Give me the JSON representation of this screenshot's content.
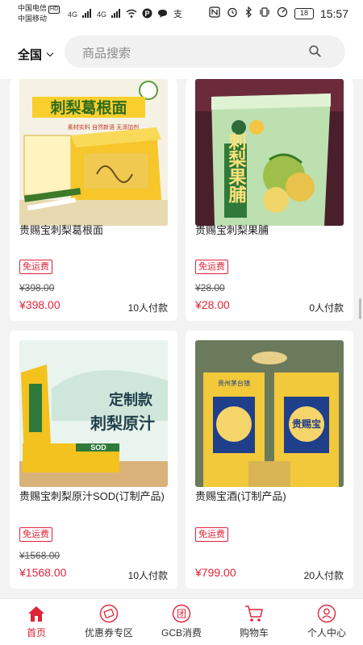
{
  "status_bar": {
    "carrier1": "中国电信",
    "carrier2": "中国移动",
    "hd": "HD",
    "net1": "4G",
    "net2": "4G",
    "battery": "18",
    "time": "15:57"
  },
  "header": {
    "region_label": "全国",
    "search_placeholder": "商品搜索"
  },
  "products": [
    {
      "name": "贵赐宝刺梨葛根面",
      "badge": "免运费",
      "original_price": "¥398.00",
      "price": "¥398.00",
      "paid_count": "10人付款",
      "image_text": {
        "title": "刺梨葛根面",
        "tags": "素材实料  自然新语  无添加剂"
      }
    },
    {
      "name": "贵赐宝刺梨果脯",
      "badge": "免运费",
      "original_price": "¥28.00",
      "price": "¥28.00",
      "paid_count": "0人付款",
      "image_text": {
        "title": "刺梨果脯"
      }
    },
    {
      "name": "贵赐宝刺梨原汁SOD(订制产品)",
      "badge": "免运费",
      "original_price": "¥1568.00",
      "price": "¥1568.00",
      "paid_count": "10人付款",
      "image_text": {
        "line1": "定制款",
        "line2": "刺梨原汁",
        "sod": "SOD"
      }
    },
    {
      "name": "贵赐宝酒(订制产品)",
      "badge": "免运费",
      "original_price": "",
      "price": "¥799.00",
      "paid_count": "20人付款",
      "image_text": {
        "label": "贵赐宝",
        "brand": "贵州茅台镇"
      }
    }
  ],
  "bottom_nav": {
    "items": [
      {
        "label": "首页",
        "icon": "home-icon",
        "active": true
      },
      {
        "label": "优惠券专区",
        "icon": "coupon-icon",
        "active": false
      },
      {
        "label": "GCB消费",
        "icon": "tuan-icon",
        "active": false
      },
      {
        "label": "购物车",
        "icon": "cart-icon",
        "active": false
      },
      {
        "label": "个人中心",
        "icon": "profile-icon",
        "active": false
      }
    ]
  },
  "colors": {
    "accent": "#e0243a",
    "page_bg": "#f3f3f3"
  }
}
